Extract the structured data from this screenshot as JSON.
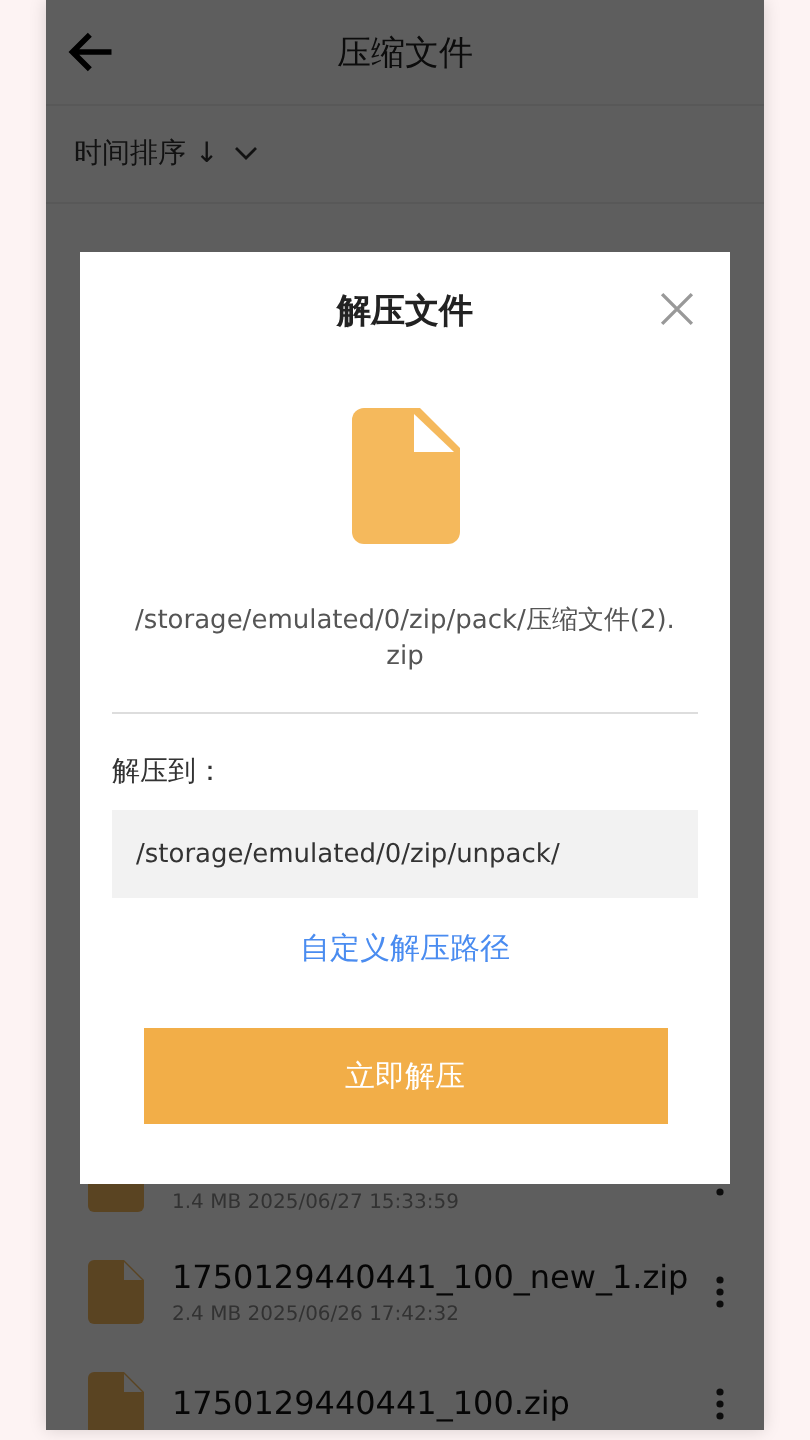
{
  "header": {
    "title": "压缩文件"
  },
  "sort": {
    "label": "时间排序 ↓"
  },
  "files": [
    {
      "meta": "1.4 MB  2025/06/27 15:33:59"
    },
    {
      "name": "1750129440441_100_new_1.zip",
      "meta": "2.4 MB  2025/06/26 17:42:32"
    },
    {
      "name": "1750129440441_100.zip"
    }
  ],
  "dialog": {
    "title": "解压文件",
    "source_path": "/storage/emulated/0/zip/pack/压缩文件(2).zip",
    "target_label": "解压到：",
    "target_path": "/storage/emulated/0/zip/unpack/",
    "custom_link": "自定义解压路径",
    "confirm_button": "立即解压"
  }
}
